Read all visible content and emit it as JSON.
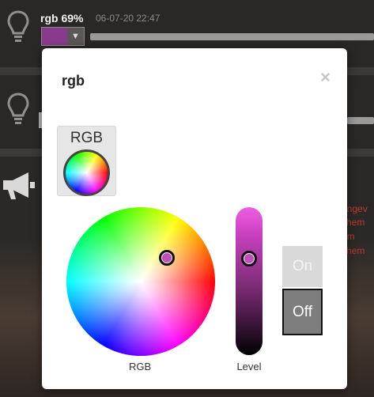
{
  "background": {
    "device": {
      "name": "rgb 69%",
      "time": "06-07-20 22:47",
      "swatch_color": "#8a3a8c",
      "dropdown_icon": "chevron-down-icon"
    },
    "red_text_lines": [
      "angev",
      "chem",
      "em",
      "chem"
    ]
  },
  "modal": {
    "title": "rgb",
    "close_label": "×",
    "mode_button_label": "RGB",
    "wheel_label": "RGB",
    "level_label": "Level",
    "on_label": "On",
    "off_label": "Off",
    "selected_color": "#c050b8",
    "state": "Off"
  },
  "colors": {
    "accent": "#c050b8",
    "off_active": "#7d7d7d",
    "on_inactive": "#d9d9d9",
    "warning_text": "#c0392b"
  }
}
